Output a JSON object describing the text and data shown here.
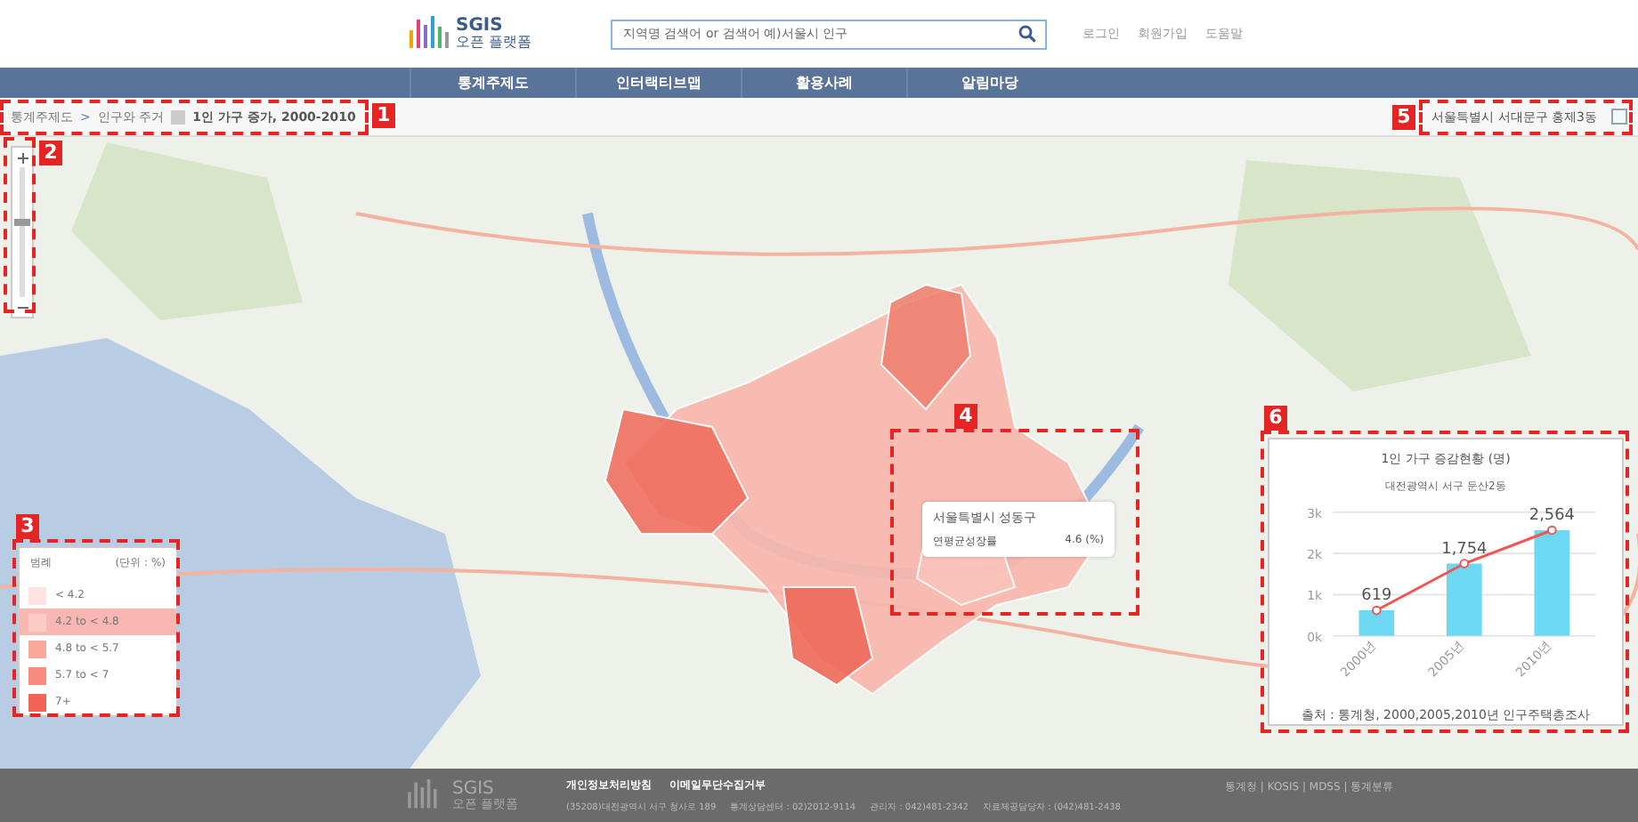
{
  "header": {
    "logo_title": "SGIS",
    "logo_subtitle": "오픈 플랫폼",
    "search": {
      "placeholder": "지역명 검색어 or 검색어 예)서울시 인구"
    },
    "links": [
      "로그인",
      "회원가입",
      "도움말"
    ]
  },
  "nav": {
    "items": [
      "통계주제도",
      "인터랙티브맵",
      "활용사례",
      "알림마당"
    ]
  },
  "breadcrumb": {
    "items": [
      "통계주제도",
      "인구와 주거"
    ],
    "separator": ">",
    "current": "1인 가구 증가, 2000-2010",
    "location": "서울특별시 서대문구 홍제3동"
  },
  "annotations": [
    "1",
    "2",
    "3",
    "4",
    "5",
    "6"
  ],
  "legend": {
    "title": "범례",
    "unit": "(단위 : %)",
    "items": [
      {
        "label": "< 4.2",
        "color": "#fde3df",
        "selected": false
      },
      {
        "label": "4.2 to < 4.8",
        "color": "#fccbc4",
        "selected": true
      },
      {
        "label": "4.8 to < 5.7",
        "color": "#f9a89c",
        "selected": false
      },
      {
        "label": "5.7 to < 7",
        "color": "#f68b7e",
        "selected": false
      },
      {
        "label": "7+",
        "color": "#f26454",
        "selected": false
      }
    ]
  },
  "tooltip": {
    "title": "서울특별시 성동구",
    "label": "연평균성장률",
    "value": "4.6 (%)"
  },
  "chart_panel": {
    "title": "1인 가구 증감현황 (명)",
    "subtitle": "대전광역시 서구 둔산2동",
    "source": "출처 : 통계청, 2000,2005,2010년 인구주택총조사",
    "chart_data": {
      "type": "bar",
      "categories": [
        "2000년",
        "2005년",
        "2010년"
      ],
      "values": [
        619,
        1754,
        2564
      ],
      "ylim": [
        0,
        3000
      ],
      "yticks": [
        {
          "value": 0,
          "label": "0k"
        },
        {
          "value": 1000,
          "label": "1k"
        },
        {
          "value": 2000,
          "label": "2k"
        },
        {
          "value": 3000,
          "label": "3k"
        }
      ],
      "value_labels": [
        "619",
        "1,754",
        "2,564"
      ]
    }
  },
  "footer": {
    "logo_title": "SGIS",
    "logo_subtitle": "오픈 플랫폼",
    "links": [
      "개인정보처리방침",
      "이메일무단수집거부"
    ],
    "address": [
      "(35208)대전광역시 서구 청사로 189",
      "통계상담센터 : 02)2012-9114",
      "관리자 : 042)481-2342",
      "자료제공담당자 : (042)481-2438"
    ],
    "related": "통계청 | KOSIS | MDSS | 통계분류"
  }
}
